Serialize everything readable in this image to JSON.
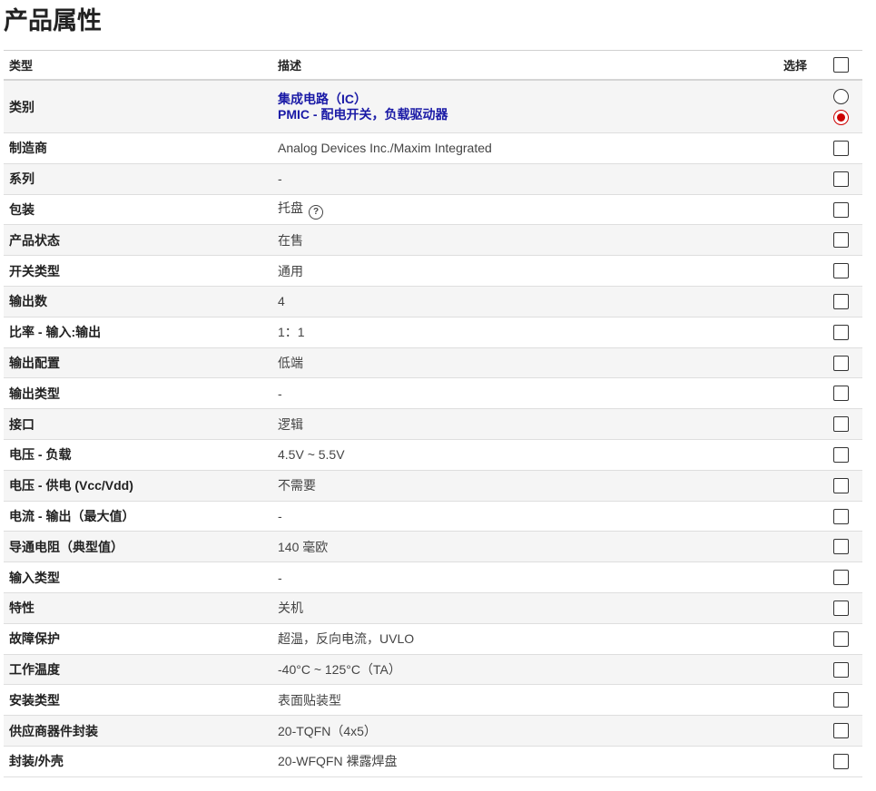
{
  "page_title": "产品属性",
  "header": {
    "type": "类型",
    "desc": "描述",
    "select": "选择"
  },
  "category": {
    "label": "类别",
    "links": [
      "集成电路（IC）",
      "PMIC - 配电开关，负载驱动器"
    ]
  },
  "rows": [
    {
      "type": "制造商",
      "desc": "Analog Devices Inc./Maxim Integrated"
    },
    {
      "type": "系列",
      "desc": "-"
    },
    {
      "type": "包装",
      "desc": "托盘",
      "help_icon": "question-circle-icon",
      "help_glyph": "?"
    },
    {
      "type": "产品状态",
      "desc": "在售"
    },
    {
      "type": "开关类型",
      "desc": "通用"
    },
    {
      "type": "输出数",
      "desc": "4"
    },
    {
      "type": "比率 - 输入:输出",
      "desc": "1：1"
    },
    {
      "type": "输出配置",
      "desc": "低端"
    },
    {
      "type": "输出类型",
      "desc": "-"
    },
    {
      "type": "接口",
      "desc": "逻辑"
    },
    {
      "type": "电压 - 负载",
      "desc": "4.5V ~ 5.5V"
    },
    {
      "type": "电压 - 供电 (Vcc/Vdd)",
      "desc": "不需要"
    },
    {
      "type": "电流 - 输出（最大值）",
      "desc": "-"
    },
    {
      "type": "导通电阻（典型值）",
      "desc": "140 毫欧"
    },
    {
      "type": "输入类型",
      "desc": "-"
    },
    {
      "type": "特性",
      "desc": "关机"
    },
    {
      "type": "故障保护",
      "desc": "超温，反向电流，UVLO"
    },
    {
      "type": "工作温度",
      "desc": "-40°C ~ 125°C（TA）"
    },
    {
      "type": "安装类型",
      "desc": "表面贴装型"
    },
    {
      "type": "供应商器件封装",
      "desc": "20-TQFN（4x5）"
    },
    {
      "type": "封装/外壳",
      "desc": "20-WFQFN 裸露焊盘"
    }
  ],
  "colors": {
    "link": "#1a1aa6",
    "radio_selected": "#cc0000",
    "alt_row": "#f5f5f5"
  }
}
